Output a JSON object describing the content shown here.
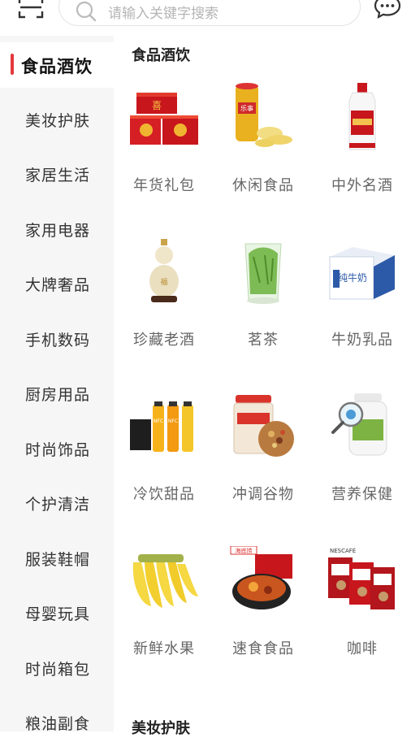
{
  "search": {
    "placeholder": "请输入关键字搜索"
  },
  "icons": {
    "scan": "scan-icon",
    "search": "search-icon",
    "messages": "message-icon"
  },
  "accent_color": "#e4393c",
  "sidebar": {
    "items": [
      {
        "label": "食品酒饮",
        "active": true
      },
      {
        "label": "美妆护肤"
      },
      {
        "label": "家居生活"
      },
      {
        "label": "家用电器"
      },
      {
        "label": "大牌奢品"
      },
      {
        "label": "手机数码"
      },
      {
        "label": "厨房用品"
      },
      {
        "label": "时尚饰品"
      },
      {
        "label": "个护清洁"
      },
      {
        "label": "服装鞋帽"
      },
      {
        "label": "母婴玩具"
      },
      {
        "label": "时尚箱包"
      },
      {
        "label": "粮油副食"
      }
    ]
  },
  "main": {
    "section_title": "食品酒饮",
    "next_section_title": "美妆护肤",
    "grid": [
      {
        "label": "年货礼包"
      },
      {
        "label": "休闲食品"
      },
      {
        "label": "中外名酒"
      },
      {
        "label": "珍藏老酒"
      },
      {
        "label": "茗茶"
      },
      {
        "label": "牛奶乳品"
      },
      {
        "label": "冷饮甜品"
      },
      {
        "label": "冲调谷物"
      },
      {
        "label": "营养保健"
      },
      {
        "label": "新鲜水果"
      },
      {
        "label": "速食食品"
      },
      {
        "label": "咖啡"
      }
    ]
  }
}
